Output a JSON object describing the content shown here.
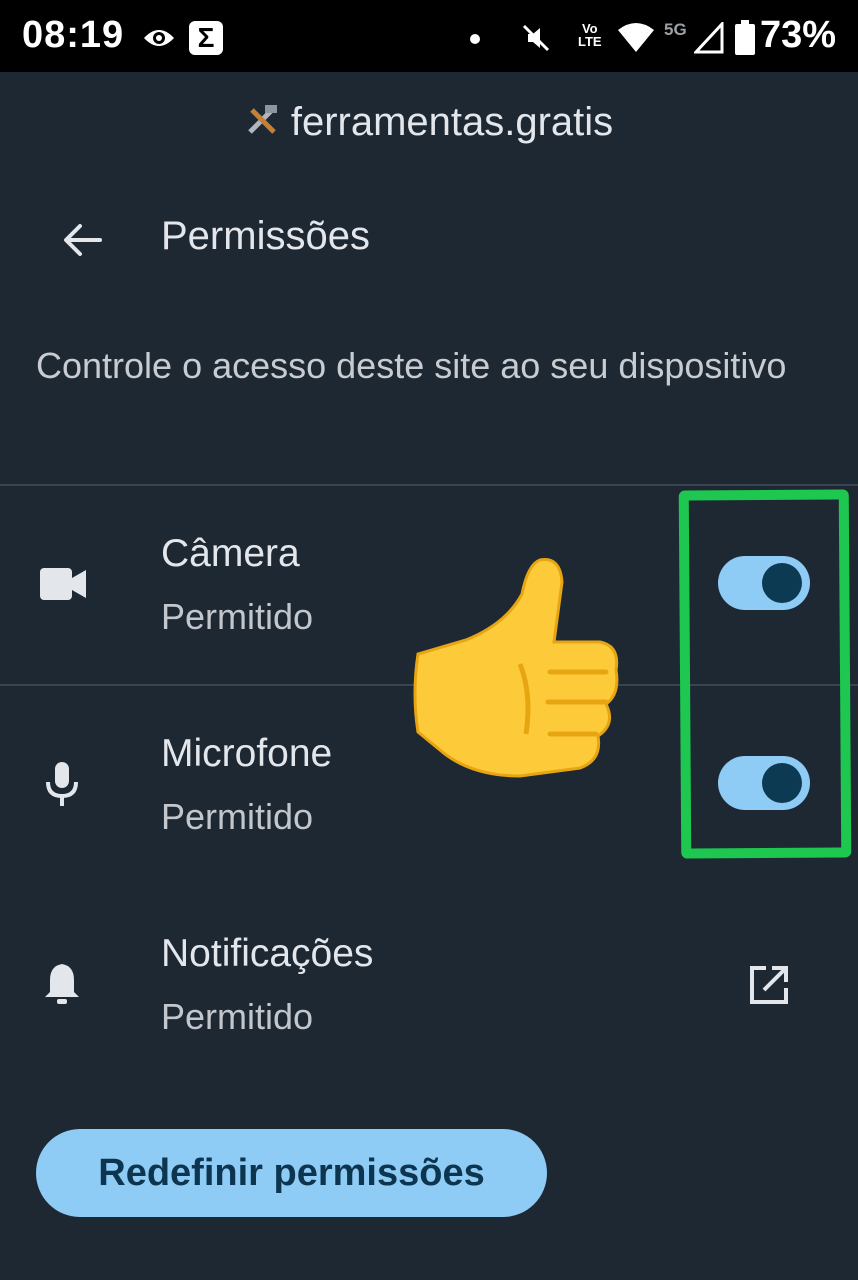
{
  "status_bar": {
    "time": "08:19",
    "network": "5G",
    "volte": "Vo LTE",
    "battery_percent": "73%",
    "icons": [
      "eye-icon",
      "sigma-app-icon",
      "notification-dot-icon",
      "mute-vibrate-icon",
      "volte-icon",
      "wifi-icon",
      "signal-icon",
      "battery-icon"
    ]
  },
  "header": {
    "site_icon": "tools-icon",
    "site_name": "ferramentas.gratis",
    "title": "Permissões",
    "description": "Controle o acesso deste site ao seu dispositivo"
  },
  "permissions": [
    {
      "name": "Câmera",
      "status": "Permitido",
      "icon": "camera-icon",
      "control": "toggle",
      "enabled": true
    },
    {
      "name": "Microfone",
      "status": "Permitido",
      "icon": "microphone-icon",
      "control": "toggle",
      "enabled": true
    },
    {
      "name": "Notificações",
      "status": "Permitido",
      "icon": "bell-icon",
      "control": "open-external"
    }
  ],
  "reset_button": {
    "label": "Redefinir permissões"
  },
  "annotations": {
    "emoji": "thumbs-up",
    "highlight_color": "#1ec74f"
  },
  "colors": {
    "background": "#1e2833",
    "accent": "#8ecbf5",
    "toggle_knob": "#0d3a53"
  }
}
